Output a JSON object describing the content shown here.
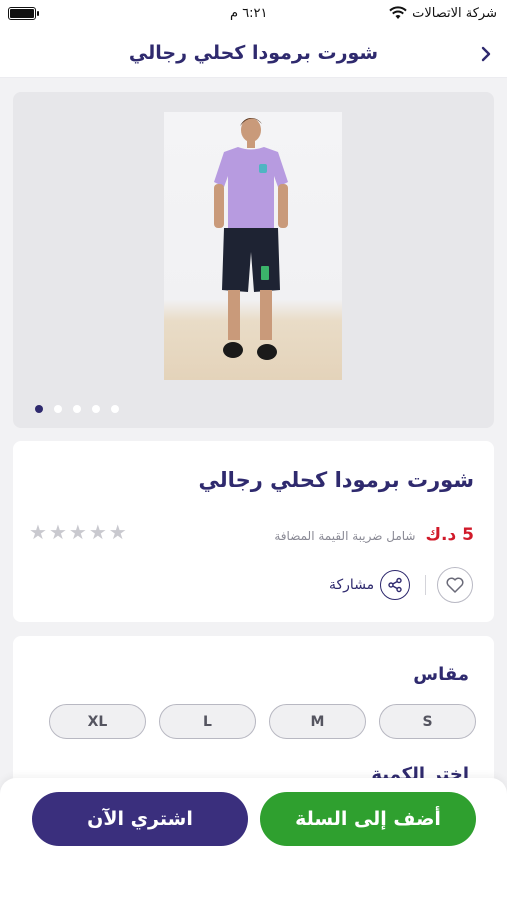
{
  "status_bar": {
    "carrier": "شركة الاتصالات",
    "time": "٦:٢١ م"
  },
  "header": {
    "title": "شورت برمودا كحلي رجالي",
    "back_icon": "chevron-right-icon"
  },
  "gallery": {
    "image_count": 5,
    "active_index": 0
  },
  "product": {
    "name": "شورت برمودا كحلي رجالي",
    "price": "5 د.ك",
    "vat_note": "شامل ضريبة القيمة المضافة",
    "rating_stars": 5,
    "rating_value": 0,
    "share_label": "مشاركة"
  },
  "size": {
    "title": "مقاس",
    "options": [
      "S",
      "M",
      "L",
      "XL"
    ]
  },
  "color": {
    "title": "اختر الكمية"
  },
  "actions": {
    "add_to_cart": "أضف إلى السلة",
    "buy_now": "اشتري الآن"
  },
  "colors": {
    "brand": "#2f2a6e",
    "price": "#d11a2a",
    "cart_button": "#2fa02f",
    "buy_button": "#3a2f7d"
  }
}
